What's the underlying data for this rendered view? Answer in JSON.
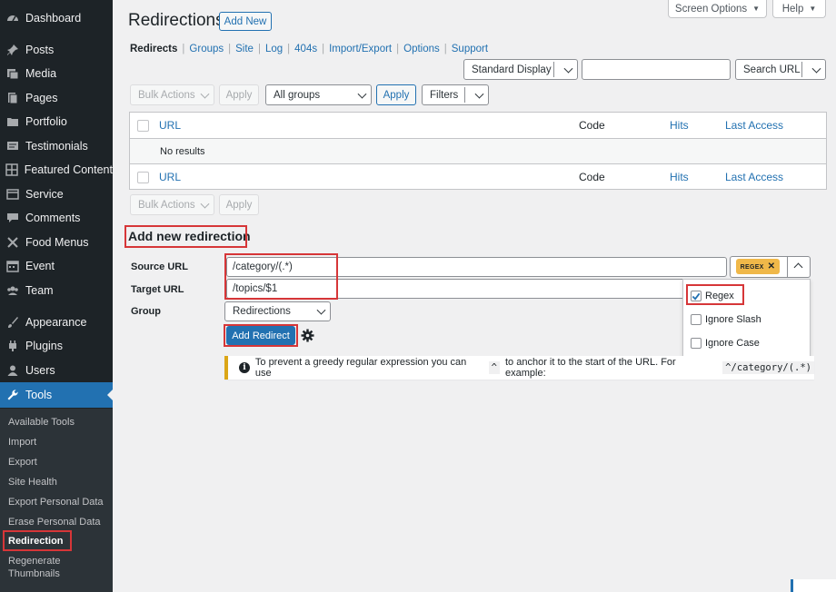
{
  "sidebar": {
    "items": [
      {
        "label": "Dashboard",
        "icon": "dashboard-icon"
      },
      {
        "label": "Posts",
        "icon": "pin-icon"
      },
      {
        "label": "Media",
        "icon": "media-icon"
      },
      {
        "label": "Pages",
        "icon": "pages-icon"
      },
      {
        "label": "Portfolio",
        "icon": "portfolio-icon"
      },
      {
        "label": "Testimonials",
        "icon": "testimonial-icon"
      },
      {
        "label": "Featured Content",
        "icon": "grid-icon"
      },
      {
        "label": "Service",
        "icon": "service-icon"
      },
      {
        "label": "Comments",
        "icon": "comment-icon"
      },
      {
        "label": "Food Menus",
        "icon": "food-icon"
      },
      {
        "label": "Event",
        "icon": "calendar-icon"
      },
      {
        "label": "Team",
        "icon": "team-icon"
      },
      {
        "label": "Appearance",
        "icon": "brush-icon"
      },
      {
        "label": "Plugins",
        "icon": "plugin-icon"
      },
      {
        "label": "Users",
        "icon": "user-icon"
      },
      {
        "label": "Tools",
        "icon": "wrench-icon"
      }
    ],
    "submenu": [
      "Available Tools",
      "Import",
      "Export",
      "Site Health",
      "Export Personal Data",
      "Erase Personal Data",
      "Redirection",
      "Regenerate",
      "Thumbnails"
    ]
  },
  "header": {
    "title": "Redirections",
    "add_new": "Add New",
    "screen_options": "Screen Options",
    "help": "Help"
  },
  "subnav": [
    "Redirects",
    "Groups",
    "Site",
    "Log",
    "404s",
    "Import/Export",
    "Options",
    "Support"
  ],
  "toolbar": {
    "display_select": "Standard Display",
    "search_value": "",
    "search_select": "Search URL",
    "bulk_actions": "Bulk Actions",
    "apply": "Apply",
    "group_select": "All groups",
    "apply2": "Apply",
    "filters": "Filters"
  },
  "table": {
    "columns": [
      "URL",
      "Code",
      "Hits",
      "Last Access"
    ],
    "empty": "No results"
  },
  "form": {
    "section_title": "Add new redirection",
    "source_label": "Source URL",
    "source_value": "/category/(.*)",
    "target_label": "Target URL",
    "target_value": "/topics/$1",
    "group_label": "Group",
    "group_value": "Redirections",
    "regex_badge": "Regex",
    "options": [
      {
        "label": "Regex",
        "checked": true
      },
      {
        "label": "Ignore Slash",
        "checked": false
      },
      {
        "label": "Ignore Case",
        "checked": false
      }
    ],
    "submit": "Add Redirect",
    "notice_text1": "To prevent a greedy regular expression you can use",
    "notice_code1": "^",
    "notice_text2": "to anchor it to the start of the URL. For example:",
    "notice_code2": "^/category/(.*)"
  },
  "colors": {
    "accent": "#2271b1",
    "highlight": "#d63638",
    "badge": "#f0b849",
    "sidebar": "#1d2327"
  }
}
